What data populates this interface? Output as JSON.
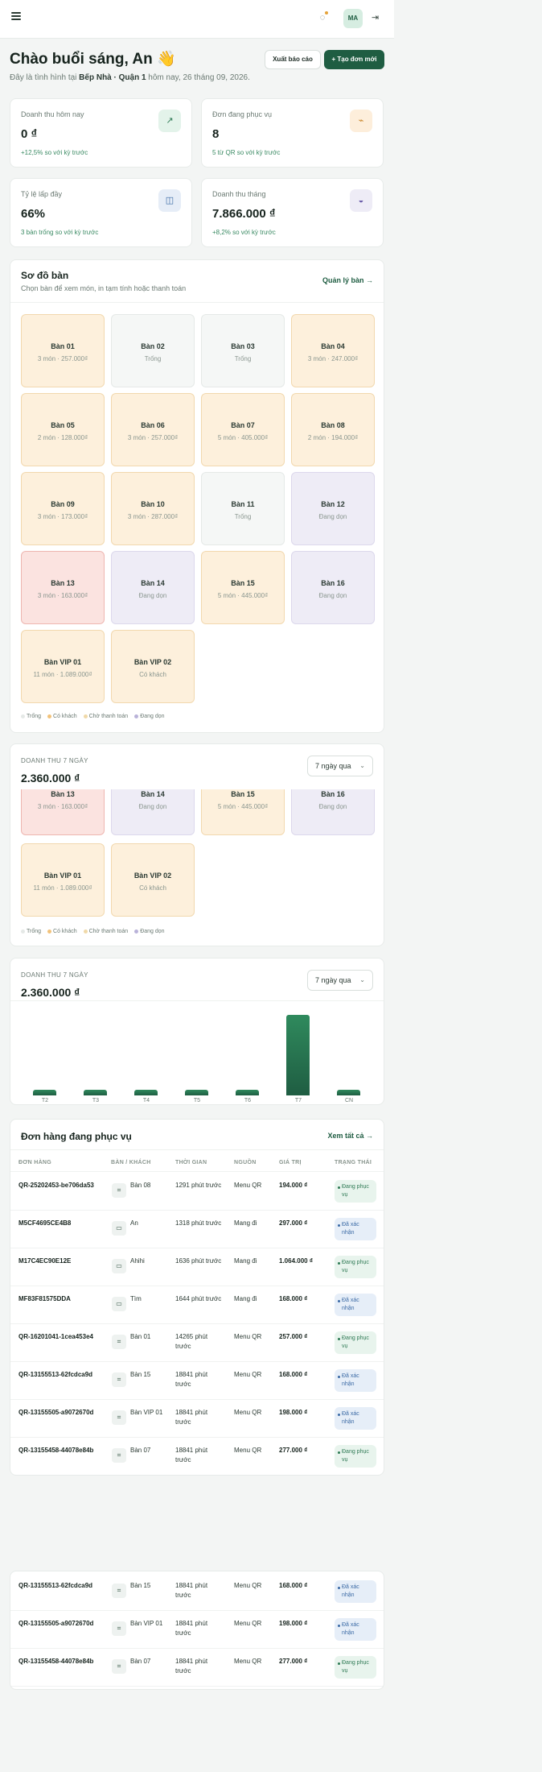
{
  "topbar": {
    "avatar_initials": "MA",
    "menu_icon": "hamburger-icon",
    "bell_icon": "bell-icon",
    "logout_icon": "logout-icon"
  },
  "header": {
    "greeting": "Chào buổi sáng, An 👋",
    "sub_prefix": "Đây là tình hình tại ",
    "restaurant": "Bếp Nhà · Quận 1",
    "sub_suffix": " hôm nay, 26 tháng 09, 2026.",
    "export_label": "Xuất báo cáo",
    "new_order_label": "+ Tạo đơn mới"
  },
  "stats": [
    {
      "label": "Doanh thu hôm nay",
      "value": "0 ₫",
      "sub": "+12,5% so với kỳ trước",
      "icon": "↗",
      "icon_bg": "#e3f3ea",
      "icon_color": "#2f7a55"
    },
    {
      "label": "Đơn đang phục vụ",
      "value": "8",
      "sub": "5 từ QR so với kỳ trước",
      "icon": "⌁",
      "icon_bg": "#fdeedb",
      "icon_color": "#c98428"
    },
    {
      "label": "Tỷ lệ lấp đầy",
      "value": "66%",
      "sub": "3 bàn trống so với kỳ trước",
      "icon": "◫",
      "icon_bg": "#e6edf7",
      "icon_color": "#3b6aa5"
    },
    {
      "label": "Doanh thu tháng",
      "value": "7.866.000 ₫",
      "sub": "+8,2% so với kỳ trước",
      "icon": "◒",
      "icon_bg": "#eeecf6",
      "icon_color": "#6a5ca8"
    }
  ],
  "floor": {
    "title": "Sơ đồ bàn",
    "subtitle": "Chọn bàn để xem món, in tạm tính hoặc thanh toán",
    "link": "Quản lý bàn →",
    "tables": [
      {
        "name": "Bàn 01",
        "info": "3 món · 257.000₫",
        "status": "busy"
      },
      {
        "name": "Bàn 02",
        "info": "Trống",
        "status": "empty"
      },
      {
        "name": "Bàn 03",
        "info": "Trống",
        "status": "empty"
      },
      {
        "name": "Bàn 04",
        "info": "3 món · 247.000₫",
        "status": "busy"
      },
      {
        "name": "Bàn 05",
        "info": "2 món · 128.000₫",
        "status": "busy"
      },
      {
        "name": "Bàn 06",
        "info": "3 món · 257.000₫",
        "status": "busy"
      },
      {
        "name": "Bàn 07",
        "info": "5 món · 405.000₫",
        "status": "busy"
      },
      {
        "name": "Bàn 08",
        "info": "2 món · 194.000₫",
        "status": "busy"
      },
      {
        "name": "Bàn 09",
        "info": "3 món · 173.000₫",
        "status": "busy"
      },
      {
        "name": "Bàn 10",
        "info": "3 món · 287.000₫",
        "status": "busy"
      },
      {
        "name": "Bàn 11",
        "info": "Trống",
        "status": "empty"
      },
      {
        "name": "Bàn 12",
        "info": "Đang dọn",
        "status": "clean"
      },
      {
        "name": "Bàn 13",
        "info": "3 món · 163.000₫",
        "status": "pay"
      },
      {
        "name": "Bàn 14",
        "info": "Đang dọn",
        "status": "clean"
      },
      {
        "name": "Bàn 15",
        "info": "5 món · 445.000₫",
        "status": "busy"
      },
      {
        "name": "Bàn 16",
        "info": "Đang dọn",
        "status": "clean"
      },
      {
        "name": "Bàn VIP 01",
        "info": "11 món · 1.089.000₫",
        "status": "busy"
      },
      {
        "name": "Bàn VIP 02",
        "info": "Có khách",
        "status": "busy"
      }
    ],
    "legend": [
      {
        "label": "Trống",
        "color": "#e5e9e7"
      },
      {
        "label": "Có khách",
        "color": "#f2c27a"
      },
      {
        "label": "Chờ thanh toán",
        "color": "#f0d9a8"
      },
      {
        "label": "Đang dọn",
        "color": "#b9b2d9"
      }
    ]
  },
  "revenue": {
    "label": "DOANH THU 7 NGÀY",
    "value": "2.360.000 ₫",
    "range": "7 ngày qua"
  },
  "chart_data": {
    "type": "bar",
    "categories": [
      "T2",
      "T3",
      "T4",
      "T5",
      "T6",
      "T7",
      "CN"
    ],
    "values": [
      120000,
      120000,
      120000,
      120000,
      120000,
      1640000,
      120000
    ],
    "ylim": [
      0,
      1800000
    ],
    "grid": false,
    "bar_color": "#1f5d42"
  },
  "orders": {
    "title": "Đơn hàng đang phục vụ",
    "link": "Xem tất cả →",
    "columns": [
      "ĐƠN HÀNG",
      "BÀN / KHÁCH",
      "THỜI GIAN",
      "NGUỒN",
      "GIÁ TRỊ",
      "TRẠNG THÁI"
    ],
    "rows": [
      {
        "code": "QR-25202453-be706da53",
        "table": "Bàn 08",
        "time": "1291 phút trước",
        "source": "Menu QR",
        "value": "194.000 ₫",
        "status": "Đang phục vụ",
        "kind": "serving",
        "icon": "table-icon"
      },
      {
        "code": "M5CF4695CE4B8",
        "table": "An",
        "time": "1318 phút trước",
        "source": "Mang đi",
        "value": "297.000 ₫",
        "status": "Đã xác nhận",
        "kind": "confirm",
        "icon": "bag-icon"
      },
      {
        "code": "M17C4EC90E12E",
        "table": "Ahihi",
        "time": "1636 phút trước",
        "source": "Mang đi",
        "value": "1.064.000 ₫",
        "status": "Đang phục vụ",
        "kind": "serving",
        "icon": "bag-icon"
      },
      {
        "code": "MF83F81575DDA",
        "table": "Tìm",
        "time": "1644 phút trước",
        "source": "Mang đi",
        "value": "168.000 ₫",
        "status": "Đã xác nhận",
        "kind": "confirm",
        "icon": "bag-icon"
      },
      {
        "code": "QR-16201041-1cea453e4",
        "table": "Bàn 01",
        "time": "14265 phút trước",
        "source": "Menu QR",
        "value": "257.000 ₫",
        "status": "Đang phục vụ",
        "kind": "serving",
        "icon": "table-icon"
      },
      {
        "code": "QR-13155513-62fcdca9d",
        "table": "Bàn 15",
        "time": "18841 phút trước",
        "source": "Menu QR",
        "value": "168.000 ₫",
        "status": "Đã xác nhận",
        "kind": "confirm",
        "icon": "table-icon"
      },
      {
        "code": "QR-13155505-a9072670d",
        "table": "Bàn VIP 01",
        "time": "18841 phút trước",
        "source": "Menu QR",
        "value": "198.000 ₫",
        "status": "Đã xác nhận",
        "kind": "confirm",
        "icon": "table-icon"
      },
      {
        "code": "QR-13155458-44078e84b",
        "table": "Bàn 07",
        "time": "18841 phút trước",
        "source": "Menu QR",
        "value": "277.000 ₫",
        "status": "Đang phục vụ",
        "kind": "serving",
        "icon": "table-icon"
      }
    ]
  }
}
